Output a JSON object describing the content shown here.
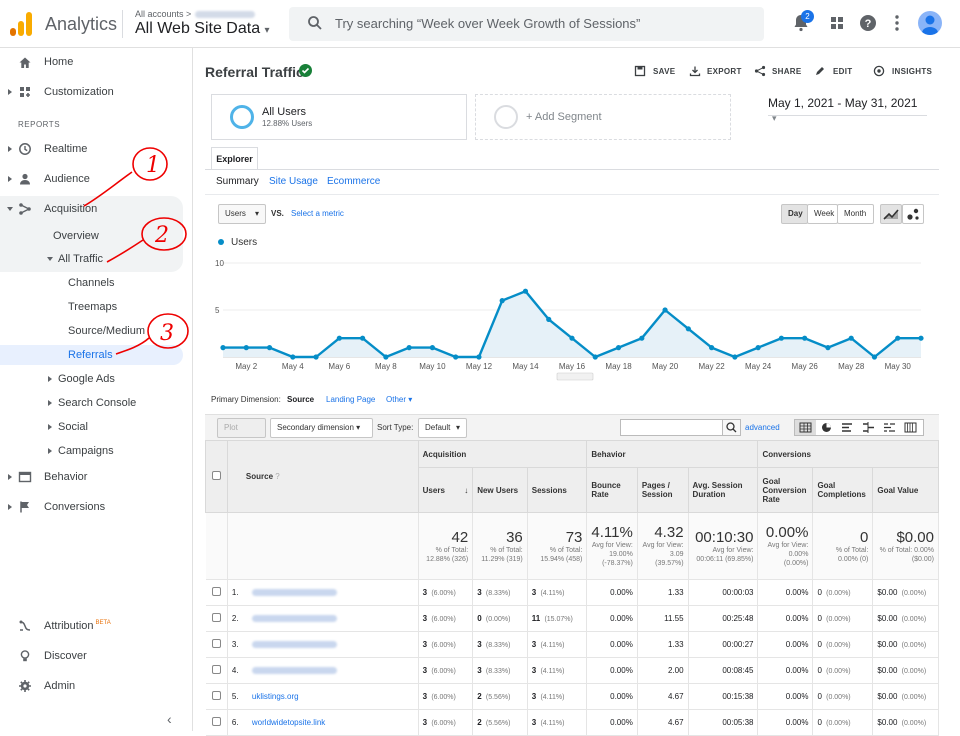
{
  "topbar": {
    "app_name": "Analytics",
    "breadcrumb": "All accounts",
    "property": "All Web Site Data",
    "search_placeholder": "Try searching “Week over Week Growth of Sessions”",
    "notifications_count": "2"
  },
  "sidebar": {
    "home": "Home",
    "customization": "Customization",
    "reports_header": "REPORTS",
    "realtime": "Realtime",
    "audience": "Audience",
    "acquisition": "Acquisition",
    "overview": "Overview",
    "all_traffic": "All Traffic",
    "channels": "Channels",
    "treemaps": "Treemaps",
    "source_medium": "Source/Medium",
    "referrals": "Referrals",
    "google_ads": "Google Ads",
    "search_console": "Search Console",
    "social": "Social",
    "campaigns": "Campaigns",
    "behavior": "Behavior",
    "conversions": "Conversions",
    "attribution": "Attribution",
    "attribution_badge": "BETA",
    "discover": "Discover",
    "admin": "Admin",
    "annotations": [
      "1",
      "2",
      "3"
    ]
  },
  "header": {
    "title": "Referral Traffic",
    "actions": {
      "save": "SAVE",
      "export": "EXPORT",
      "share": "SHARE",
      "edit": "EDIT",
      "insights": "INSIGHTS"
    }
  },
  "segments": {
    "primary_name": "All Users",
    "primary_sub": "12.88% Users",
    "add": "+ Add Segment"
  },
  "date_range": "May 1, 2021 - May 31, 2021",
  "explorer": {
    "tab": "Explorer",
    "subtabs": [
      "Summary",
      "Site Usage",
      "Ecommerce"
    ],
    "metric": "Users",
    "vs": "VS.",
    "select_metric": "Select a metric",
    "granularity": [
      "Day",
      "Week",
      "Month"
    ]
  },
  "chart_data": {
    "type": "line",
    "series": [
      {
        "name": "Users",
        "values": [
          1,
          1,
          1,
          0,
          0,
          2,
          2,
          0,
          1,
          1,
          0,
          0,
          6,
          7,
          4,
          2,
          0,
          1,
          2,
          5,
          3,
          1,
          0,
          1,
          2,
          2,
          1,
          2,
          0,
          2,
          2
        ]
      }
    ],
    "x_tick_labels": [
      "May 2",
      "May 4",
      "May 6",
      "May 8",
      "May 10",
      "May 12",
      "May 14",
      "May 16",
      "May 18",
      "May 20",
      "May 22",
      "May 24",
      "May 26",
      "May 28",
      "May 30"
    ],
    "y_tick_labels": [
      "10",
      "5"
    ],
    "ylim": [
      0,
      10
    ],
    "color": "#058dc7"
  },
  "dimension": {
    "label": "Primary Dimension:",
    "active": "Source",
    "others": [
      "Landing Page",
      "Other"
    ]
  },
  "tools": {
    "plot_rows": "Plot Rows",
    "secondary": "Secondary dimension",
    "sort_label": "Sort Type:",
    "sort_value": "Default",
    "advanced": "advanced"
  },
  "table": {
    "groups": [
      "Acquisition",
      "Behavior",
      "Conversions"
    ],
    "columns": [
      "Source",
      "Users",
      "New Users",
      "Sessions",
      "Bounce Rate",
      "Pages / Session",
      "Avg. Session Duration",
      "Goal Conversion Rate",
      "Goal Completions",
      "Goal Value"
    ],
    "totals": [
      {
        "value": "42",
        "sub": "% of Total: 12.88% (326)"
      },
      {
        "value": "36",
        "sub": "% of Total: 11.29% (319)"
      },
      {
        "value": "73",
        "sub": "% of Total: 15.94% (458)"
      },
      {
        "value": "4.11%",
        "sub": "Avg for View: 19.00% (-78.37%)"
      },
      {
        "value": "4.32",
        "sub": "Avg for View: 3.09 (39.57%)"
      },
      {
        "value": "00:10:30",
        "sub": "Avg for View: 00:06:11 (69.85%)"
      },
      {
        "value": "0.00%",
        "sub": "Avg for View: 0.00% (0.00%)"
      },
      {
        "value": "0",
        "sub": "% of Total: 0.00% (0)"
      },
      {
        "value": "$0.00",
        "sub": "% of Total: 0.00% ($0.00)"
      }
    ],
    "rows": [
      {
        "idx": "1.",
        "source": "",
        "users": "3",
        "users_pct": "(6.00%)",
        "new": "3",
        "new_pct": "(8.33%)",
        "sess": "3",
        "sess_pct": "(4.11%)",
        "bounce": "0.00%",
        "pps": "1.33",
        "dur": "00:00:03",
        "gcr": "0.00%",
        "gc": "0",
        "gc_pct": "(0.00%)",
        "gv": "$0.00",
        "gv_pct": "(0.00%)"
      },
      {
        "idx": "2.",
        "source": "",
        "users": "3",
        "users_pct": "(6.00%)",
        "new": "0",
        "new_pct": "(0.00%)",
        "sess": "11",
        "sess_pct": "(15.07%)",
        "bounce": "0.00%",
        "pps": "11.55",
        "dur": "00:25:48",
        "gcr": "0.00%",
        "gc": "0",
        "gc_pct": "(0.00%)",
        "gv": "$0.00",
        "gv_pct": "(0.00%)"
      },
      {
        "idx": "3.",
        "source": "",
        "users": "3",
        "users_pct": "(6.00%)",
        "new": "3",
        "new_pct": "(8.33%)",
        "sess": "3",
        "sess_pct": "(4.11%)",
        "bounce": "0.00%",
        "pps": "1.33",
        "dur": "00:00:27",
        "gcr": "0.00%",
        "gc": "0",
        "gc_pct": "(0.00%)",
        "gv": "$0.00",
        "gv_pct": "(0.00%)"
      },
      {
        "idx": "4.",
        "source": "",
        "users": "3",
        "users_pct": "(6.00%)",
        "new": "3",
        "new_pct": "(8.33%)",
        "sess": "3",
        "sess_pct": "(4.11%)",
        "bounce": "0.00%",
        "pps": "2.00",
        "dur": "00:08:45",
        "gcr": "0.00%",
        "gc": "0",
        "gc_pct": "(0.00%)",
        "gv": "$0.00",
        "gv_pct": "(0.00%)"
      },
      {
        "idx": "5.",
        "source": "uklistings.org",
        "users": "3",
        "users_pct": "(6.00%)",
        "new": "2",
        "new_pct": "(5.56%)",
        "sess": "3",
        "sess_pct": "(4.11%)",
        "bounce": "0.00%",
        "pps": "4.67",
        "dur": "00:15:38",
        "gcr": "0.00%",
        "gc": "0",
        "gc_pct": "(0.00%)",
        "gv": "$0.00",
        "gv_pct": "(0.00%)"
      },
      {
        "idx": "6.",
        "source": "worldwidetopsite.link",
        "users": "3",
        "users_pct": "(6.00%)",
        "new": "2",
        "new_pct": "(5.56%)",
        "sess": "3",
        "sess_pct": "(4.11%)",
        "bounce": "0.00%",
        "pps": "4.67",
        "dur": "00:05:38",
        "gcr": "0.00%",
        "gc": "0",
        "gc_pct": "(0.00%)",
        "gv": "$0.00",
        "gv_pct": "(0.00%)"
      }
    ]
  }
}
